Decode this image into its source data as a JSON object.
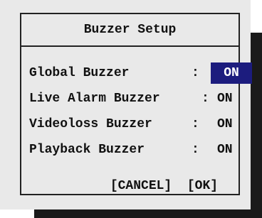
{
  "dialog": {
    "title": "Buzzer Setup",
    "rows": [
      {
        "label": "Global Buzzer",
        "separator": ":",
        "value": "ON",
        "selected": true
      },
      {
        "label": "Live Alarm Buzzer",
        "separator": ":",
        "value": "ON",
        "selected": false
      },
      {
        "label": "Videoloss Buzzer",
        "separator": ":",
        "value": "ON",
        "selected": false
      },
      {
        "label": "Playback Buzzer",
        "separator": ":",
        "value": "ON",
        "selected": false
      }
    ],
    "cancel_label": "[CANCEL]",
    "ok_label": "[OK]"
  },
  "colors": {
    "selection_bg": "#1c1c7e",
    "panel_bg": "#e9e9e9",
    "shadow": "#1a1a1a"
  }
}
